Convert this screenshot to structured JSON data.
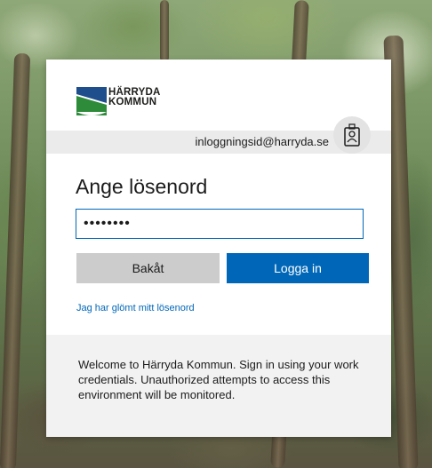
{
  "brand": {
    "logo_line1": "HÄRRYDA",
    "logo_line2": "KOMMUN",
    "logo_colors": {
      "blue": "#1e4e8c",
      "green": "#2e8b3a"
    }
  },
  "identity": {
    "email": "inloggningsid@harryda.se",
    "badge_icon": "id-badge-icon"
  },
  "form": {
    "title": "Ange lösenord",
    "password_value": "••••••••",
    "back_button": "Bakåt",
    "login_button": "Logga in",
    "forgot_link": "Jag har glömt mitt lösenord"
  },
  "footer": {
    "text": "Welcome to Härryda Kommun. Sign in using your work credentials. Unauthorized attempts to access this environment will be monitored."
  },
  "colors": {
    "primary": "#0067b8",
    "secondary_button": "#cccccc",
    "footer_bg": "#f2f2f2"
  }
}
